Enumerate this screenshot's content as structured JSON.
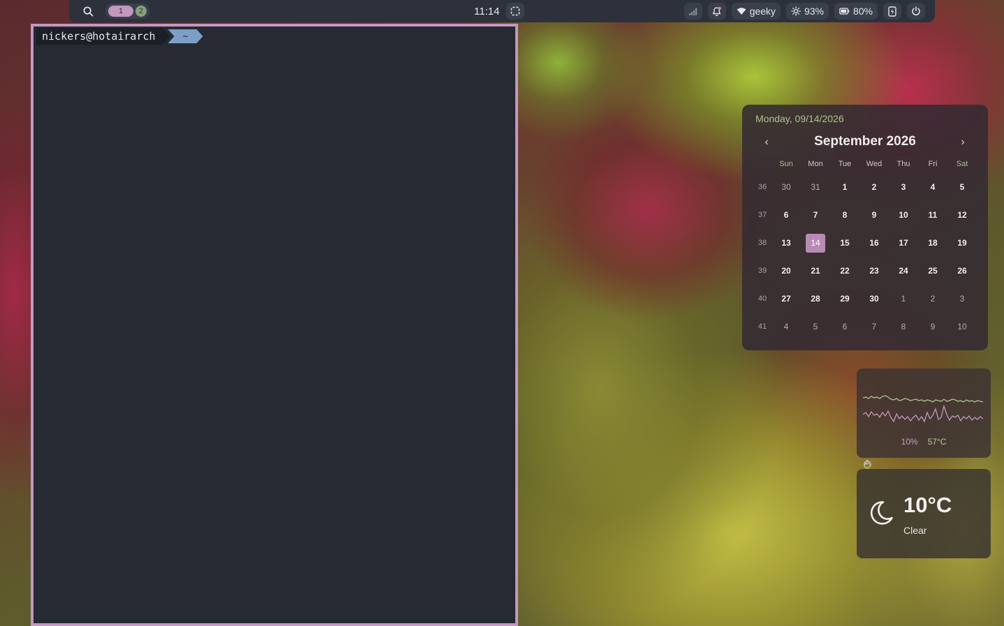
{
  "topbar": {
    "search_icon": "search-icon",
    "workspaces": [
      {
        "label": "1",
        "active": true
      },
      {
        "label": "2",
        "active": false
      }
    ],
    "clock": "11:14",
    "screenshot_icon": "region-select-icon",
    "tray": {
      "signal_icon": "cellular-signal-icon",
      "notification_icon": "bell-icon",
      "wifi_name": "geeky",
      "brightness": "93%",
      "battery": "80%",
      "power_profile_icon": "performance-icon",
      "power_icon": "power-icon"
    }
  },
  "terminal": {
    "user_host": "nickers@hotairarch",
    "cwd": "~"
  },
  "calendar": {
    "full_date": "Monday, 09/14/2026",
    "month_title": "September 2026",
    "weekdays": [
      "Sun",
      "Mon",
      "Tue",
      "Wed",
      "Thu",
      "Fri",
      "Sat"
    ],
    "weeks": [
      {
        "num": "36",
        "days": [
          {
            "d": "30",
            "m": "other"
          },
          {
            "d": "31",
            "m": "other"
          },
          {
            "d": "1",
            "m": "cur"
          },
          {
            "d": "2",
            "m": "cur"
          },
          {
            "d": "3",
            "m": "cur"
          },
          {
            "d": "4",
            "m": "cur"
          },
          {
            "d": "5",
            "m": "cur"
          }
        ]
      },
      {
        "num": "37",
        "days": [
          {
            "d": "6",
            "m": "cur"
          },
          {
            "d": "7",
            "m": "cur"
          },
          {
            "d": "8",
            "m": "cur"
          },
          {
            "d": "9",
            "m": "cur"
          },
          {
            "d": "10",
            "m": "cur"
          },
          {
            "d": "11",
            "m": "cur"
          },
          {
            "d": "12",
            "m": "cur"
          }
        ]
      },
      {
        "num": "38",
        "days": [
          {
            "d": "13",
            "m": "cur"
          },
          {
            "d": "14",
            "m": "today"
          },
          {
            "d": "15",
            "m": "cur"
          },
          {
            "d": "16",
            "m": "cur"
          },
          {
            "d": "17",
            "m": "cur"
          },
          {
            "d": "18",
            "m": "cur"
          },
          {
            "d": "19",
            "m": "cur"
          }
        ]
      },
      {
        "num": "39",
        "days": [
          {
            "d": "20",
            "m": "cur"
          },
          {
            "d": "21",
            "m": "cur"
          },
          {
            "d": "22",
            "m": "cur"
          },
          {
            "d": "23",
            "m": "cur"
          },
          {
            "d": "24",
            "m": "cur"
          },
          {
            "d": "25",
            "m": "cur"
          },
          {
            "d": "26",
            "m": "cur"
          }
        ]
      },
      {
        "num": "40",
        "days": [
          {
            "d": "27",
            "m": "cur"
          },
          {
            "d": "28",
            "m": "cur"
          },
          {
            "d": "29",
            "m": "cur"
          },
          {
            "d": "30",
            "m": "cur"
          },
          {
            "d": "1",
            "m": "other"
          },
          {
            "d": "2",
            "m": "other"
          },
          {
            "d": "3",
            "m": "other"
          }
        ]
      },
      {
        "num": "41",
        "days": [
          {
            "d": "4",
            "m": "other"
          },
          {
            "d": "5",
            "m": "other"
          },
          {
            "d": "6",
            "m": "other"
          },
          {
            "d": "7",
            "m": "other"
          },
          {
            "d": "8",
            "m": "other"
          },
          {
            "d": "9",
            "m": "other"
          },
          {
            "d": "10",
            "m": "other"
          }
        ]
      }
    ]
  },
  "sysmon": {
    "cpu_usage": "10%",
    "cpu_temp": "57°C"
  },
  "weather": {
    "icon": "moon-icon",
    "temperature": "10°C",
    "condition": "Clear"
  },
  "colors": {
    "accent_pink": "#c397c0",
    "accent_green": "#a9c58e",
    "bar_bg": "#2c313c",
    "terminal_bg": "#252a33",
    "path_segment": "#7c9fc7"
  }
}
